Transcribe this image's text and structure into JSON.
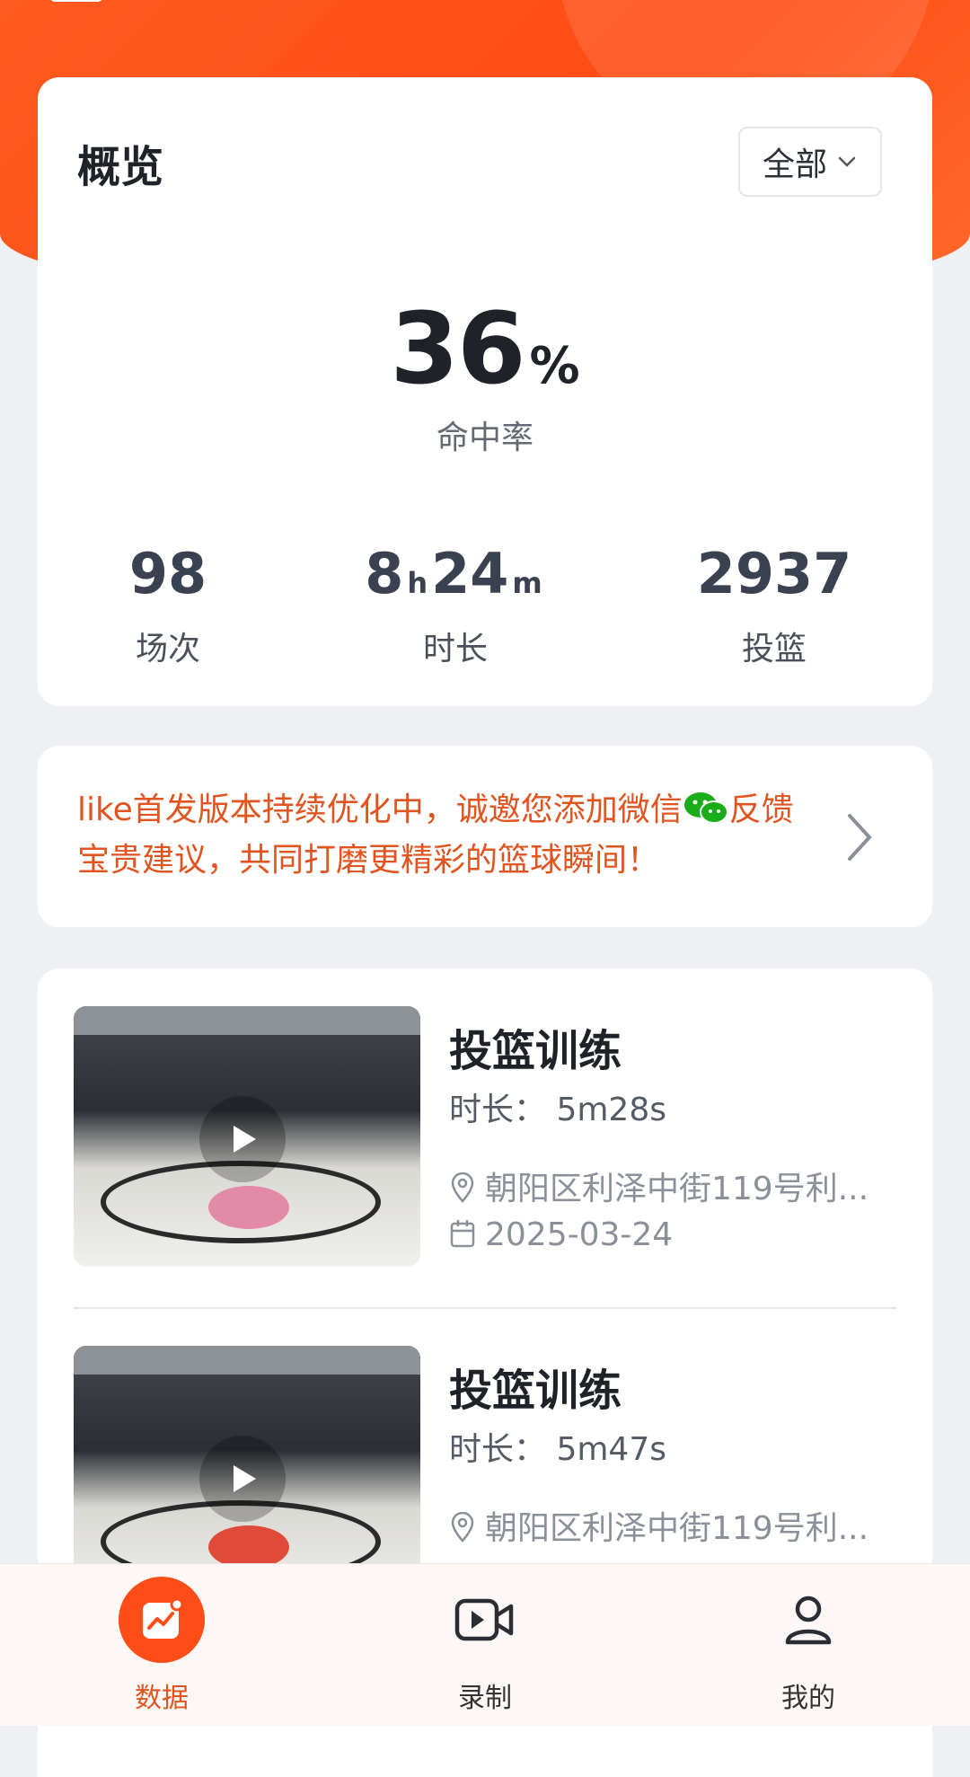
{
  "overview": {
    "title": "概览",
    "filter": "全部",
    "hit_rate_value": "36",
    "hit_rate_unit": "%",
    "hit_rate_label": "命中率",
    "stats": {
      "games": {
        "value": "98",
        "label": "场次"
      },
      "duration": {
        "hours": "8",
        "hours_unit": "h",
        "minutes": "24",
        "minutes_unit": "m",
        "label": "时长"
      },
      "shots": {
        "value": "2937",
        "label": "投篮"
      }
    }
  },
  "notice": {
    "text_before": "like首发版本持续优化中，诚邀您添加微信",
    "text_after": "反馈宝贵建议，共同打磨更精彩的篮球瞬间！"
  },
  "sessions": [
    {
      "title": "投篮训练",
      "duration": "时长：  5m28s",
      "location": "朝阳区利泽中街119号利...",
      "date": "2025-03-24"
    },
    {
      "title": "投篮训练",
      "duration": "时长：  5m47s",
      "location": "朝阳区利泽中街119号利...",
      "date": ""
    }
  ],
  "tabs": [
    {
      "label": "数据",
      "icon": "chart-icon"
    },
    {
      "label": "录制",
      "icon": "video-icon"
    },
    {
      "label": "我的",
      "icon": "user-icon"
    }
  ],
  "colors": {
    "accent": "#ff4d17",
    "notice": "#e2541f"
  }
}
